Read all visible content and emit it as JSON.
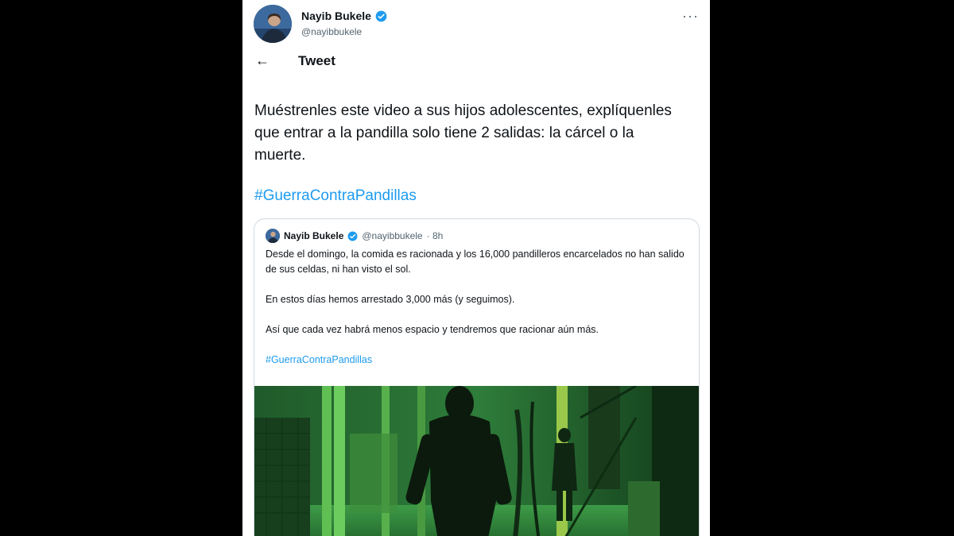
{
  "author": {
    "name": "Nayib Bukele",
    "handle": "@nayibbukele"
  },
  "header": {
    "back_icon": "arrow-left-icon",
    "title": "Tweet",
    "more_icon": "more-horizontal-icon"
  },
  "tweet": {
    "text": "Muéstrenles este video a sus hijos adolescentes, explíquenles que entrar a la pandilla solo tiene 2 salidas: la cárcel o la muerte.",
    "hashtag": "#GuerraContraPandillas"
  },
  "quoted_tweet": {
    "name": "Nayib Bukele",
    "handle": "@nayibbukele",
    "time": "· 8h",
    "paragraphs": [
      "Desde el domingo, la comida es racionada y los 16,000 pandilleros encarcelados no han salido de sus celdas, ni han visto el sol.",
      "En estos días hemos arrestado 3,000 más (y seguimos).",
      "Así que cada vez habrá menos espacio y tendremos que racionar aún más."
    ],
    "hashtag": "#GuerraContraPandillas"
  },
  "colors": {
    "link": "#1d9bf0",
    "text": "#0f1419",
    "muted": "#536471",
    "video_green": "#2f8a3a"
  }
}
